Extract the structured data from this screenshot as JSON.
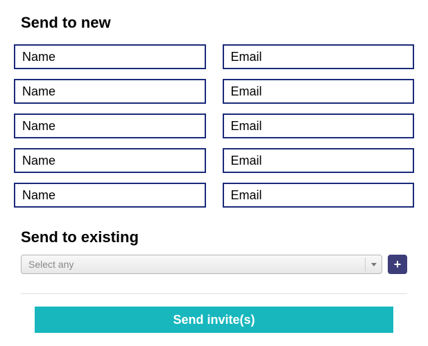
{
  "send_new": {
    "heading": "Send to new",
    "rows": [
      {
        "name_placeholder": "Name",
        "email_placeholder": "Email"
      },
      {
        "name_placeholder": "Name",
        "email_placeholder": "Email"
      },
      {
        "name_placeholder": "Name",
        "email_placeholder": "Email"
      },
      {
        "name_placeholder": "Name",
        "email_placeholder": "Email"
      },
      {
        "name_placeholder": "Name",
        "email_placeholder": "Email"
      }
    ]
  },
  "send_existing": {
    "heading": "Send to existing",
    "select_placeholder": "Select any",
    "add_label": "+"
  },
  "submit": {
    "label": "Send invite(s)"
  }
}
